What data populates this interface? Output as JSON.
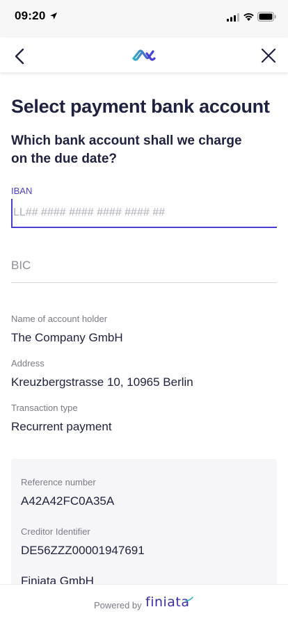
{
  "status_bar": {
    "time": "09:20",
    "icons": [
      "location-arrow-icon",
      "cellular-signal-icon",
      "wifi-icon",
      "battery-icon"
    ]
  },
  "nav": {
    "back_icon": "chevron-left-icon",
    "logo_icon": "infinity-logo-icon",
    "close_icon": "close-icon"
  },
  "page": {
    "title": "Select payment bank account",
    "subtitle": "Which bank account shall we charge on the due date?"
  },
  "form": {
    "iban": {
      "label": "IBAN",
      "value": "",
      "placeholder": "LL## #### #### #### #### ##"
    },
    "bic": {
      "value": "",
      "placeholder": "BIC"
    }
  },
  "details": {
    "holder_label": "Name of account holder",
    "holder_value": "The Company GmbH",
    "address_label": "Address",
    "address_value": "Kreuzbergstrasse 10, 10965 Berlin",
    "type_label": "Transaction type",
    "type_value": "Recurrent payment"
  },
  "reference_card": {
    "ref_label": "Reference number",
    "ref_value": "A42A42FC0A35A",
    "creditor_label": "Creditor Identifier",
    "creditor_value": "DE56ZZZ00001947691",
    "company_name": "Finiata GmbH"
  },
  "footer": {
    "powered_by": "Powered by",
    "brand": "finiata"
  },
  "colors": {
    "accent": "#4b3fd1",
    "text": "#1f2140",
    "muted": "#7c7c86",
    "card_bg": "#f6f6f8"
  }
}
